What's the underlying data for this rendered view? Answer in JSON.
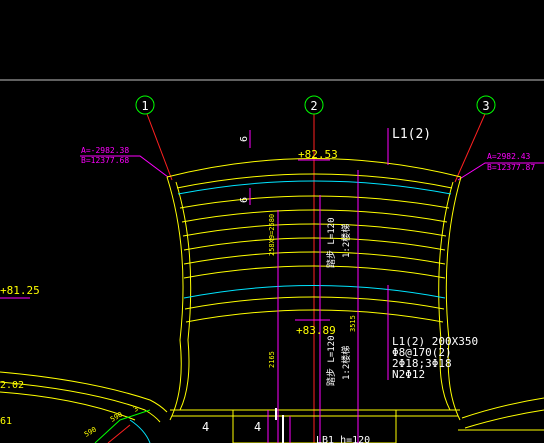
{
  "colors": {
    "background": "#000000",
    "yellow": "#ffff00",
    "cyan": "#00e5ff",
    "magenta": "#ff00ff",
    "red": "#ff2020",
    "green": "#00ff00",
    "white": "#ffffff",
    "gray": "#a0a0a0"
  },
  "axes": {
    "axis_1": "1",
    "axis_2": "2",
    "axis_3": "3"
  },
  "annotations": {
    "left_coord_a": "A=-2982.38",
    "left_coord_b": "B=12377.68",
    "right_coord_a": "A=2982.43",
    "right_coord_b": "B=12377.87",
    "top_elevation": "+82.53",
    "mid_elevation": "+83.89",
    "left_elevation": "+81.25",
    "left_elevation_small": "2.02",
    "left_number_small": "61",
    "beam_label_top": "L1(2)",
    "beam_spec_line1": "L1(2) 200X350",
    "beam_spec_line2": "Φ8@170(2)",
    "beam_spec_line3": "2Φ18;3Φ18",
    "beam_spec_line4": "N2Φ12",
    "section_marker_top": "6",
    "section_marker_mid": "6",
    "section_marker_b1": "4",
    "section_marker_b2": "4",
    "dim_top_vertical": "258X9=2580",
    "dim_lower_vertical": "2165",
    "dim_right_vertical": "3515",
    "stair_label_top_a": "踏步 L=120",
    "stair_label_top_b": "1:2楼梯",
    "stair_label_bottom_a": "踏步 L=120",
    "stair_label_bottom_b": "1:2楼梯",
    "bottom_beam_label": "LB1 h=120",
    "bottom_dim_1": "590",
    "bottom_dim_2": "590",
    "bottom_dim_3": "3"
  }
}
